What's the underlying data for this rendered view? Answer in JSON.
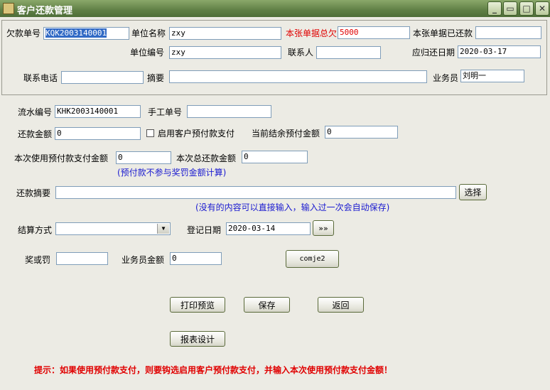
{
  "window": {
    "title": "客户还款管理",
    "controls": {
      "minimize": "_",
      "restore": "▭",
      "maximize": "□",
      "close": "✕"
    }
  },
  "header": {
    "debt_no_label": "欠款单号",
    "debt_no_value": "KQK2003140001",
    "unit_name_label": "单位名称",
    "unit_name_value": "zxy",
    "total_debt_label": "本张单据总欠",
    "total_debt_value": "5000",
    "paid_label": "本张单据已还款",
    "paid_value": "",
    "unit_code_label": "单位编号",
    "unit_code_value": "zxy",
    "contact_label": "联系人",
    "contact_value": "",
    "due_date_label": "应归还日期",
    "due_date_value": "2020-03-17",
    "phone_label": "联系电话",
    "phone_value": "",
    "summary_label": "摘要",
    "summary_value": "",
    "salesman_label": "业务员",
    "salesman_value": "刘明一"
  },
  "form": {
    "serial_label": "流水编号",
    "serial_value": "KHK2003140001",
    "manual_no_label": "手工单号",
    "manual_no_value": "",
    "repay_amount_label": "还款金额",
    "repay_amount_value": "0",
    "use_prepay_label": "启用客户预付款支付",
    "use_prepay_checked": false,
    "prepay_balance_label": "当前结余预付金额",
    "prepay_balance_value": "0",
    "prepay_used_label": "本次使用预付款支付金额",
    "prepay_used_value": "0",
    "total_repay_label": "本次总还款金额",
    "total_repay_value": "0",
    "prepay_note": "(预付款不参与奖罚金额计算)",
    "repay_summary_label": "还款摘要",
    "repay_summary_value": "",
    "select_button": "选择",
    "summary_note": "(没有的内容可以直接输入，输入过一次会自动保存)",
    "settle_method_label": "结算方式",
    "settle_method_value": "",
    "register_date_label": "登记日期",
    "register_date_value": "2020-03-14",
    "date_picker_button": "»»",
    "reward_penalty_label": "奖或罚",
    "reward_penalty_value": "",
    "salesman_amount_label": "业务员金额",
    "salesman_amount_value": "0",
    "comje_button": "comje2"
  },
  "actions": {
    "print_preview": "打印预览",
    "save": "保存",
    "back": "返回",
    "report_design": "报表设计"
  },
  "tip": "提示：如果使用预付款支付，则要钩选启用客户预付款支付，并输入本次使用预付款支付金额！"
}
